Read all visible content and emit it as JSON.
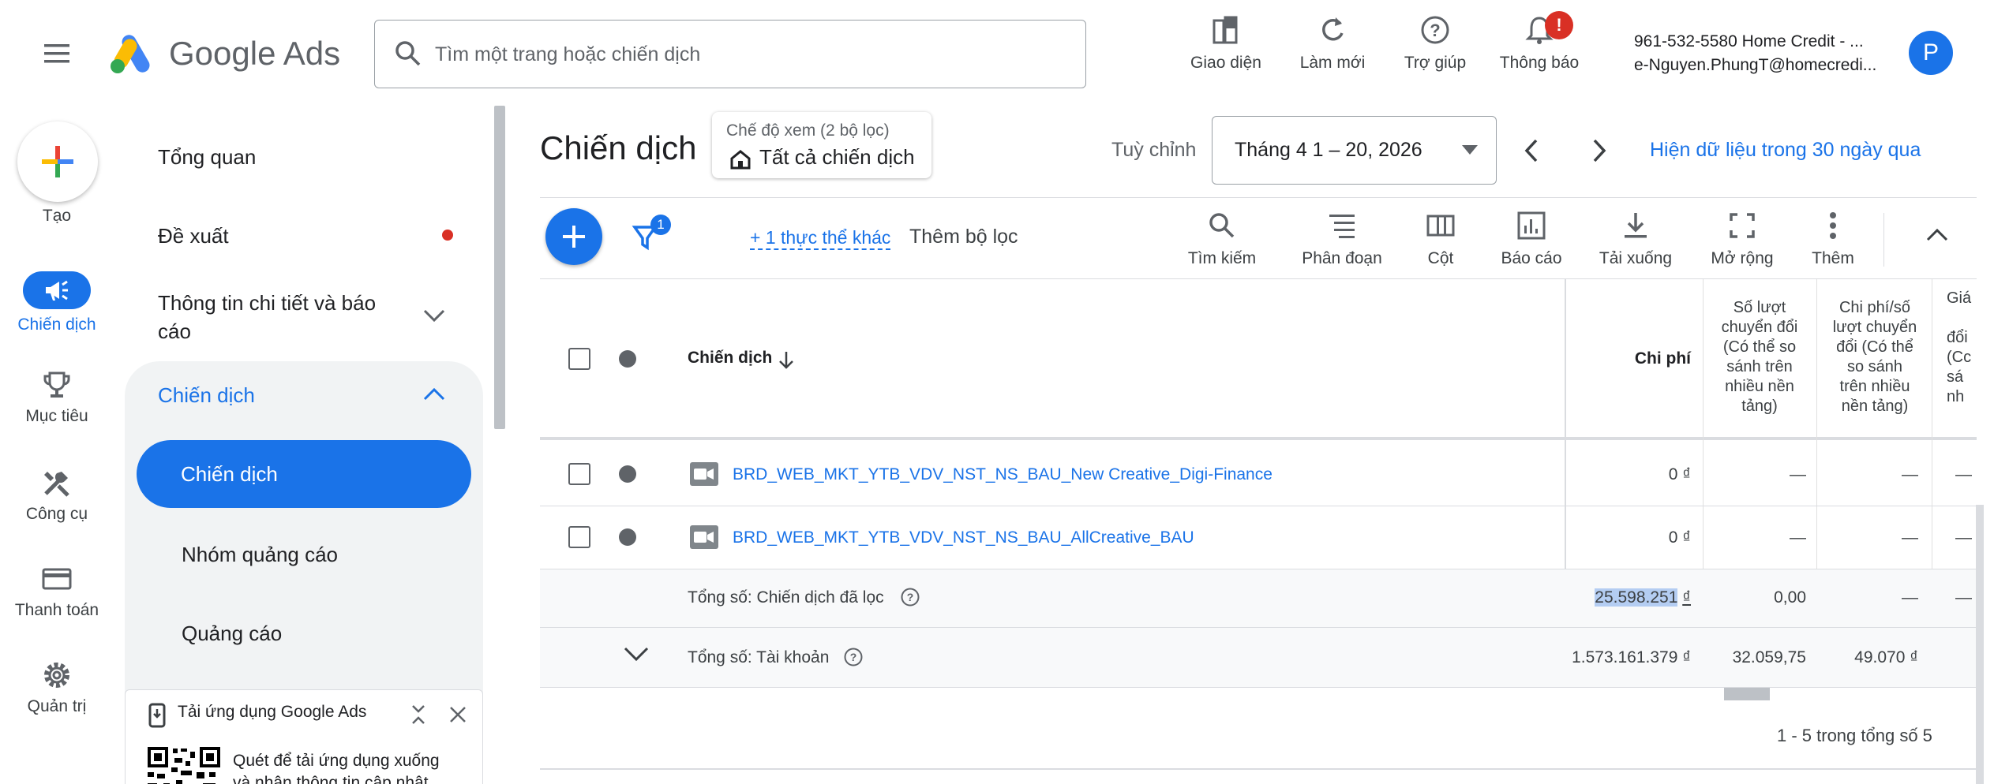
{
  "header": {
    "brand": "Google Ads",
    "search_placeholder": "Tìm một trang hoặc chiến dịch",
    "tools": [
      {
        "label": "Giao diện",
        "icon": "appearance-icon"
      },
      {
        "label": "Làm mới",
        "icon": "refresh-icon"
      },
      {
        "label": "Trợ giúp",
        "icon": "help-icon"
      },
      {
        "label": "Thông báo",
        "icon": "bell-icon",
        "badge": "!"
      }
    ],
    "account_line1": "961-532-5580 Home Credit - ...",
    "account_line2": "e-Nguyen.PhungT@homecredi...",
    "avatar_letter": "P"
  },
  "rail": {
    "create": "Tạo",
    "items": [
      {
        "label": "Chiến dịch",
        "icon": "campaign-icon",
        "active": true
      },
      {
        "label": "Mục tiêu",
        "icon": "trophy-icon"
      },
      {
        "label": "Công cụ",
        "icon": "tools-icon"
      },
      {
        "label": "Thanh toán",
        "icon": "credit-card-icon"
      },
      {
        "label": "Quản trị",
        "icon": "settings-icon"
      }
    ]
  },
  "nav": {
    "overview": "Tổng quan",
    "recommendations": "Đề xuất",
    "insights_line1": "Thông tin chi tiết và báo",
    "insights_line2": "cáo",
    "campaigns_section": "Chiến dịch",
    "sub_items": [
      "Chiến dịch",
      "Nhóm quảng cáo",
      "Quảng cáo"
    ]
  },
  "app_promo": {
    "title": "Tải ứng dụng Google Ads",
    "body_line1": "Quét để tải ứng dụng xuống",
    "body_line2": "và nhận thông tin cập nhật"
  },
  "main": {
    "title": "Chiến dịch",
    "view_mode_label": "Chế độ xem (2 bộ lọc)",
    "view_mode_value": "Tất cả chiến dịch",
    "customize_label": "Tuỳ chỉnh",
    "date_range": "Tháng 4 1 – 20, 2026",
    "show_30_days": "Hiện dữ liệu trong 30 ngày qua"
  },
  "toolbar": {
    "filter_count": "1",
    "more_entities": "+ 1 thực thể khác",
    "add_filter": "Thêm bộ lọc",
    "buttons": [
      "Tìm kiếm",
      "Phân đoạn",
      "Cột",
      "Báo cáo",
      "Tải xuống",
      "Mở rộng",
      "Thêm"
    ]
  },
  "table": {
    "headers": {
      "campaign": "Chiến dịch",
      "cost": "Chi phí",
      "conversions": [
        "Số lượt",
        "chuyển đổi",
        "(Có thể so",
        "sánh trên",
        "nhiều nền",
        "tảng)"
      ],
      "cost_per_conv": [
        "Chi phí/số",
        "lượt chuyển",
        "đổi (Có thể",
        "so sánh",
        "trên nhiều",
        "nền tảng)"
      ],
      "value_partial": [
        "Giá",
        "",
        "đổi",
        "(Cc",
        "sá",
        "nh"
      ]
    },
    "rows": [
      {
        "name": "BRD_WEB_MKT_YTB_VDV_NST_NS_BAU_New Creative_Digi-Finance",
        "cost": "0 ₫",
        "conv": "—",
        "cpc": "—",
        "val": "—"
      },
      {
        "name": "BRD_WEB_MKT_YTB_VDV_NST_NS_BAU_AllCreative_BAU",
        "cost": "0 ₫",
        "conv": "—",
        "cpc": "—",
        "val": "—"
      }
    ],
    "total_filtered": {
      "label": "Tổng số: Chiến dịch đã lọc",
      "cost_num": "25.598.251",
      "cost_cur": "₫",
      "conv": "0,00",
      "cpc": "—",
      "val": "—"
    },
    "total_account": {
      "label": "Tổng số: Tài khoản",
      "cost": "1.573.161.379 ₫",
      "conv": "32.059,75",
      "cpc": "49.070 ₫",
      "val": "—"
    },
    "pagination": "1 - 5 trong tổng số 5"
  },
  "colors": {
    "accent": "#1a73e8",
    "alert": "#d93025"
  }
}
